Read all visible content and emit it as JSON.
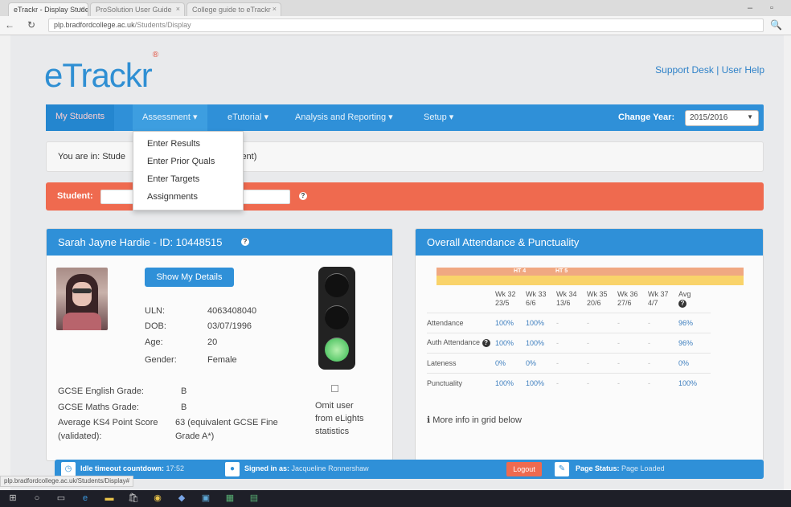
{
  "browser": {
    "tabs": [
      {
        "label": "eTrackr - Display Student"
      },
      {
        "label": "ProSolution User Guide"
      },
      {
        "label": "College guide to eTrackr"
      }
    ],
    "url_host": "plp.bradfordcollege.ac.uk",
    "url_path": "/Students/Display"
  },
  "app": {
    "logo_text": "eTrackr",
    "logo_mark": "®",
    "support_links": "Support Desk | User Help"
  },
  "nav": {
    "my_students": "My Students",
    "assessment": "Assessment ▾",
    "etutorial": "eTutorial ▾",
    "analysis": "Analysis and Reporting ▾",
    "setup": "Setup ▾",
    "change_year_label": "Change Year:",
    "year_value": "2015/2016"
  },
  "assessment_menu": {
    "items": [
      {
        "label": "Enter Results"
      },
      {
        "label": "Enter Prior Quals"
      },
      {
        "label": "Enter Targets"
      },
      {
        "label": "Assignments"
      }
    ]
  },
  "breadcrumb": {
    "start": "You are in: Stude",
    "end": "lent)"
  },
  "student_search": {
    "label": "Student:"
  },
  "profile": {
    "header": "Sarah Jayne Hardie - ID: 10448515",
    "show_details": "Show My Details",
    "uln_label": "ULN:",
    "uln_value": "4063408040",
    "dob_label": "DOB:",
    "dob_value": "03/07/1996",
    "age_label": "Age:",
    "age_value": "20",
    "gender_label": "Gender:",
    "gender_value": "Female",
    "gcse_english_label": "GCSE English Grade:",
    "gcse_english_value": "B",
    "gcse_maths_label": "GCSE Maths Grade:",
    "gcse_maths_value": "B",
    "ks4_label_1": "Average KS4 Point Score",
    "ks4_label_2": "(validated):",
    "ks4_value_1": "63 (equivalent GCSE Fine",
    "ks4_value_2": "Grade A*)",
    "omit_1": "Omit user",
    "omit_2": "from eLights",
    "omit_3": "statistics"
  },
  "attendance": {
    "header": "Overall Attendance & Punctuality",
    "band_labels": [
      "HT 4",
      "HT 5"
    ],
    "columns": [
      {
        "line1": "Wk 32",
        "line2": "23/5"
      },
      {
        "line1": "Wk 33",
        "line2": "6/6"
      },
      {
        "line1": "Wk 34",
        "line2": "13/6"
      },
      {
        "line1": "Wk 35",
        "line2": "20/6"
      },
      {
        "line1": "Wk 36",
        "line2": "27/6"
      },
      {
        "line1": "Wk 37",
        "line2": "4/7"
      },
      {
        "line1": "Avg",
        "line2": ""
      }
    ],
    "rows": [
      {
        "label": "Attendance",
        "cells": [
          "100%",
          "100%",
          "-",
          "-",
          "-",
          "-",
          "96%"
        ]
      },
      {
        "label": "Auth Attendance",
        "cells": [
          "100%",
          "100%",
          "-",
          "-",
          "-",
          "-",
          "96%"
        ]
      },
      {
        "label": "Lateness",
        "cells": [
          "0%",
          "0%",
          "-",
          "-",
          "-",
          "-",
          "0%"
        ]
      },
      {
        "label": "Punctuality",
        "cells": [
          "100%",
          "100%",
          "-",
          "-",
          "-",
          "-",
          "100%"
        ]
      }
    ],
    "more_info": "More info in grid below"
  },
  "status": {
    "idle_label": "Idle timeout countdown:",
    "idle_value": "17:52",
    "signed_label": "Signed in as:",
    "signed_value": "Jacqueline Ronnershaw",
    "logout": "Logout",
    "page_status_label": "Page Status:",
    "page_status_value": "Page Loaded"
  },
  "hover_url": "plp.bradfordcollege.ac.uk/Students/Display#",
  "colors": {
    "nav_blue": "#2f90d8",
    "student_bar": "#ef6a4f",
    "traffic_light_active": "#5ac96b"
  }
}
